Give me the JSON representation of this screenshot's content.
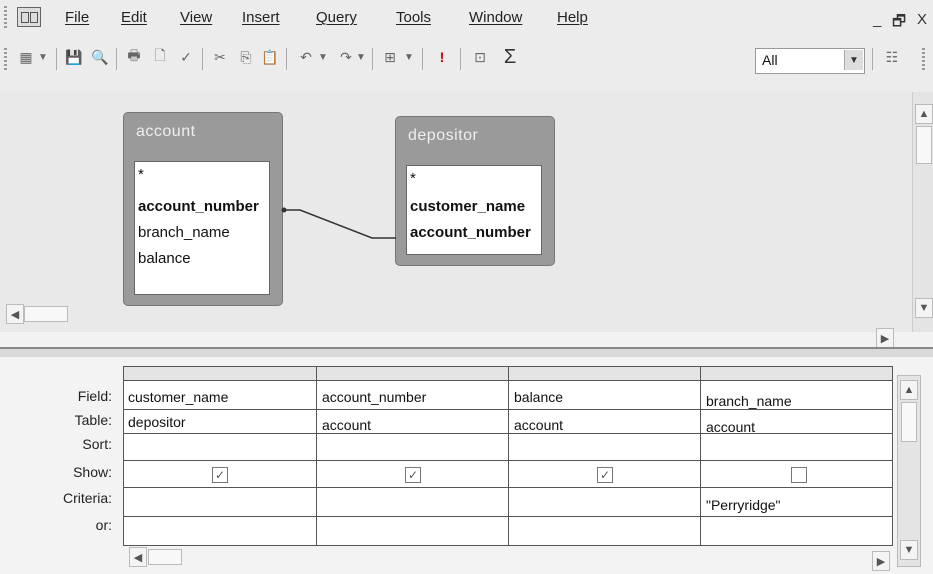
{
  "menubar": {
    "items": [
      "File",
      "Edit",
      "View",
      "Insert",
      "Query",
      "Tools",
      "Window",
      "Help"
    ],
    "window_controls": {
      "minimize": "_",
      "restore": "&#x1D13;",
      "close": "X"
    }
  },
  "toolbar": {
    "sum_symbol": "Σ",
    "top_values": "All",
    "run_symbol": "!"
  },
  "design": {
    "tables": [
      {
        "name": "account",
        "fields": [
          "*",
          "account_number",
          "branch_name",
          "balance"
        ],
        "bold_fields": [
          "account_number"
        ]
      },
      {
        "name": "depositor",
        "fields": [
          "*",
          "customer_name",
          "account_number"
        ],
        "bold_fields": [
          "customer_name",
          "account_number"
        ]
      }
    ]
  },
  "grid": {
    "row_labels": [
      "Field:",
      "Table:",
      "Sort:",
      "Show:",
      "Criteria:",
      "or:"
    ],
    "columns": [
      {
        "field": "customer_name",
        "table": "depositor",
        "sort": "",
        "show": true,
        "criteria": "",
        "or": ""
      },
      {
        "field": "account_number",
        "table": "account",
        "sort": "",
        "show": true,
        "criteria": "",
        "or": ""
      },
      {
        "field": "balance",
        "table": "account",
        "sort": "",
        "show": true,
        "criteria": "",
        "or": ""
      },
      {
        "field": "branch_name",
        "table": "account",
        "sort": "",
        "show": false,
        "criteria": "\"Perryridge\"",
        "or": ""
      }
    ]
  },
  "colors": {
    "title_bar_gray": "#9a9a9a",
    "background": "#f2f2f2"
  }
}
